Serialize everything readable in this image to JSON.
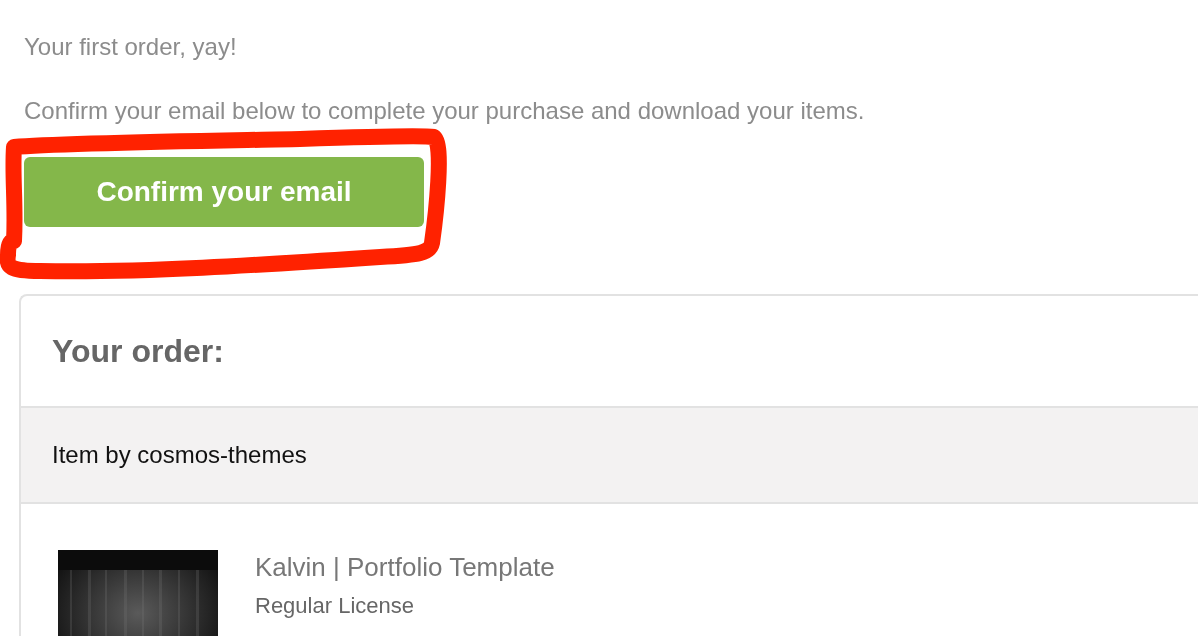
{
  "intro": {
    "greeting": "Your first order, yay!",
    "message": "Confirm your email below to complete your purchase and download your items."
  },
  "confirm_button": {
    "label": "Confirm your email"
  },
  "order": {
    "title": "Your order:",
    "seller": "Item by cosmos-themes",
    "items": [
      {
        "title": "Kalvin | Portfolio Template",
        "license": "Regular License"
      }
    ]
  }
}
